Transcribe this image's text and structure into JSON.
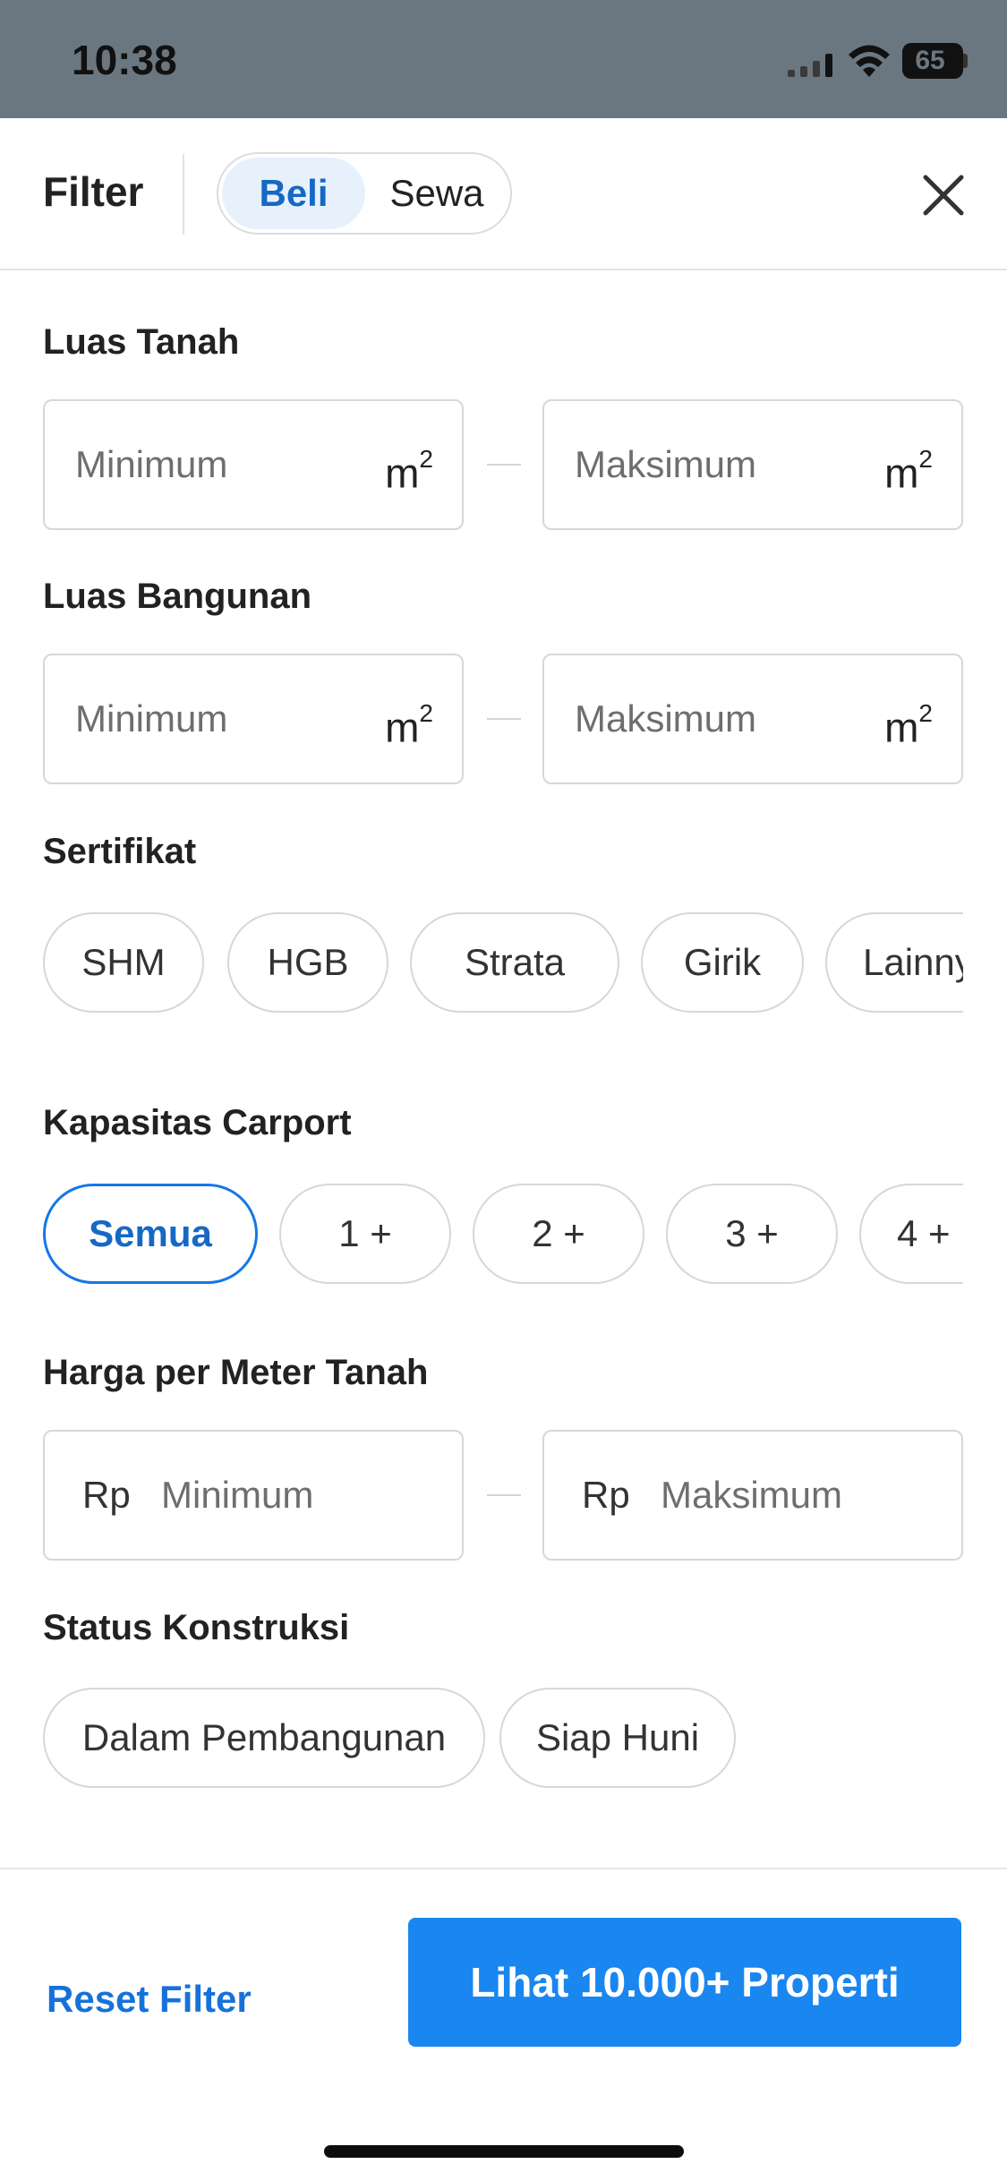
{
  "status_bar": {
    "time": "10:38",
    "battery": "65",
    "icons": [
      "signal-icon",
      "wifi-icon",
      "battery-icon"
    ]
  },
  "header": {
    "title": "Filter",
    "segments": [
      {
        "label": "Beli",
        "active": true
      },
      {
        "label": "Sewa",
        "active": false
      }
    ],
    "close_icon": "close-icon"
  },
  "sections": {
    "luas_tanah": {
      "title": "Luas Tanah",
      "min_placeholder": "Minimum",
      "max_placeholder": "Maksimum",
      "unit": "m",
      "unit_sup": "2"
    },
    "luas_bangunan": {
      "title": "Luas Bangunan",
      "min_placeholder": "Minimum",
      "max_placeholder": "Maksimum",
      "unit": "m",
      "unit_sup": "2"
    },
    "sertifikat": {
      "title": "Sertifikat",
      "options": [
        "SHM",
        "HGB",
        "Strata",
        "Girik",
        "Lainnya"
      ]
    },
    "kapasitas_carport": {
      "title": "Kapasitas Carport",
      "options": [
        "Semua",
        "1 +",
        "2 +",
        "3 +",
        "4 +"
      ],
      "selected": "Semua"
    },
    "harga_per_meter": {
      "title": "Harga per Meter Tanah",
      "prefix": "Rp",
      "min_placeholder": "Minimum",
      "max_placeholder": "Maksimum"
    },
    "status_konstruksi": {
      "title": "Status Konstruksi",
      "options": [
        "Dalam Pembangunan",
        "Siap Huni"
      ]
    }
  },
  "footer": {
    "reset_label": "Reset Filter",
    "cta_label": "Lihat 10.000+ Properti"
  },
  "colors": {
    "accent": "#1a86f0",
    "accent_text": "#1668c4",
    "status_bar_bg": "#6b7780"
  }
}
